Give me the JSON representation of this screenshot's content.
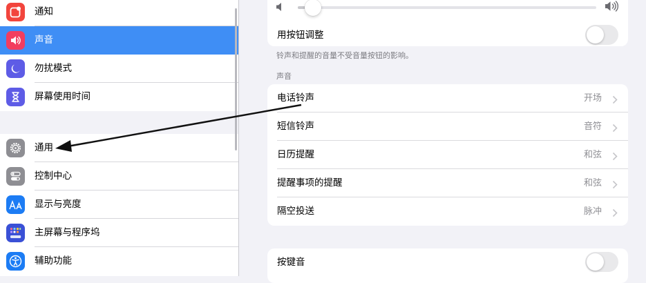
{
  "sidebar": {
    "items": [
      {
        "label": "通知",
        "icon": "notifications-icon",
        "color": "#f2453d"
      },
      {
        "label": "声音",
        "icon": "speaker-icon",
        "color": "#f23d5f",
        "selected": true
      },
      {
        "label": "勿扰模式",
        "icon": "moon-icon",
        "color": "#5e5ce6"
      },
      {
        "label": "屏幕使用时间",
        "icon": "hourglass-icon",
        "color": "#5e5ce6"
      },
      {
        "label": "通用",
        "icon": "gear-icon",
        "color": "#8e8e93"
      },
      {
        "label": "控制中心",
        "icon": "toggles-icon",
        "color": "#8e8e93"
      },
      {
        "label": "显示与亮度",
        "icon": "text-size-icon",
        "color": "#1c7cf4"
      },
      {
        "label": "主屏幕与程序坞",
        "icon": "home-grid-icon",
        "color": "#3a50d6"
      },
      {
        "label": "辅助功能",
        "icon": "accessibility-icon",
        "color": "#1c7cf4"
      }
    ]
  },
  "detail": {
    "volume_level": 0.05,
    "button_adjust": {
      "label": "用按钮调整",
      "on": false
    },
    "note": "铃声和提醒的音量不受音量按钮的影响。",
    "section_title": "声音",
    "sounds": [
      {
        "label": "电话铃声",
        "value": "开场"
      },
      {
        "label": "短信铃声",
        "value": "音符"
      },
      {
        "label": "日历提醒",
        "value": "和弦"
      },
      {
        "label": "提醒事项的提醒",
        "value": "和弦"
      },
      {
        "label": "隔空投送",
        "value": "脉冲"
      }
    ],
    "key_clicks": {
      "label": "按键音",
      "on": false
    }
  },
  "colors": {
    "selection": "#3f8ef5",
    "background": "#f2f2f7",
    "annotation_arrow": "#111111"
  }
}
